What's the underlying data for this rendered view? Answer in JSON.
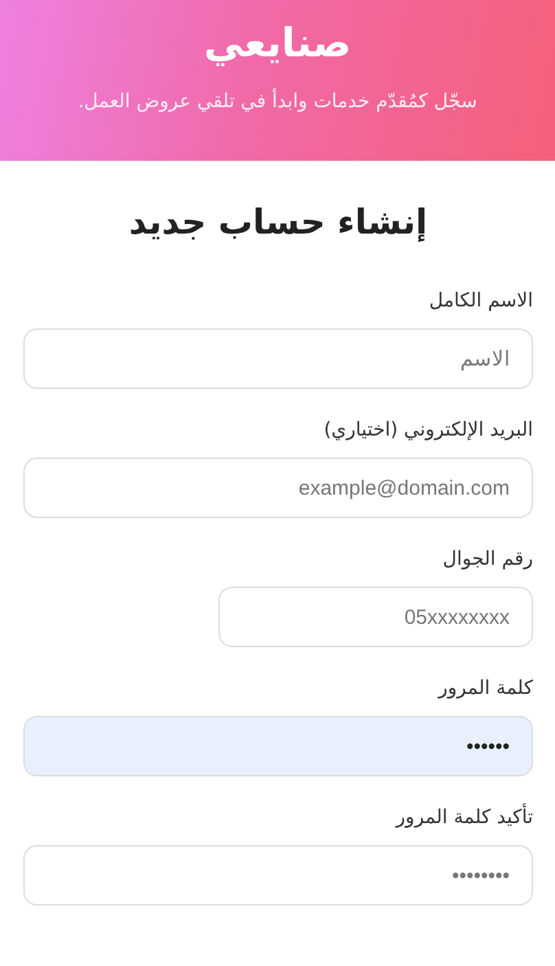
{
  "header": {
    "title": "صنايعي",
    "subtitle": "سجّل كمُقدّم خدمات وابدأ في تلقي عروض العمل."
  },
  "form": {
    "title": "إنشاء حساب جديد",
    "fields": [
      {
        "kind": "text",
        "label": "الاسم الكامل",
        "placeholder": "الاسم",
        "autofilled": false
      },
      {
        "kind": "email",
        "label": "البريد الإلكتروني (اختياري)",
        "placeholder": "example@domain.com",
        "autofilled": false
      },
      {
        "kind": "phone",
        "label": "رقم الجوال",
        "placeholder": "05xxxxxxxx",
        "autofilled": false
      },
      {
        "kind": "password",
        "label": "كلمة المرور",
        "value": "••••••",
        "autofilled": true
      },
      {
        "kind": "password",
        "label": "تأكيد كلمة المرور",
        "placeholder": "••••••••",
        "autofilled": false
      }
    ]
  }
}
